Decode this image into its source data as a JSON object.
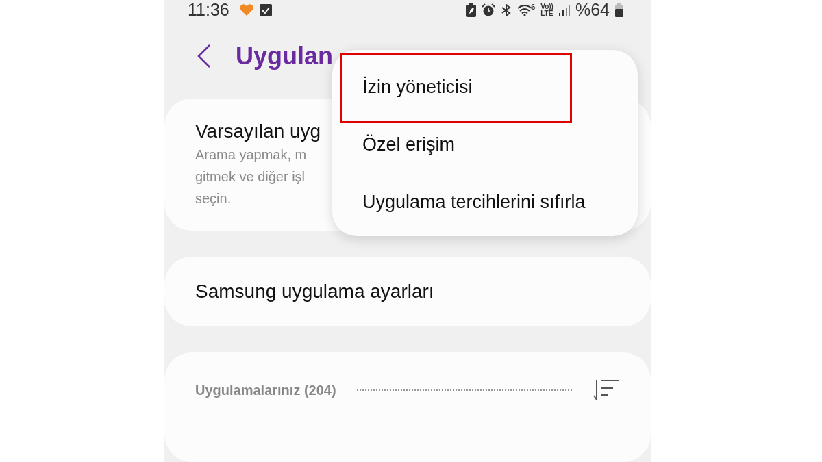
{
  "status_bar": {
    "time": "11:36",
    "wifi_badge": "6",
    "volte_top": "Vo))",
    "volte_bottom": "LTE",
    "battery_percent": "%64"
  },
  "header": {
    "title": "Uygulan"
  },
  "cards": [
    {
      "kind": "default_apps",
      "title": "Varsayılan uyg",
      "subtitle_lines": [
        "Arama yapmak, m",
        "gitmek ve diğer işl",
        "seçin."
      ]
    },
    {
      "kind": "plain",
      "title": "Samsung uygulama ayarları"
    },
    {
      "kind": "apps_header",
      "title": "Uygulamalarınız (204)"
    }
  ],
  "menu": {
    "items": [
      {
        "label": "İzin yöneticisi",
        "highlighted": true
      },
      {
        "label": "Özel erişim",
        "highlighted": false
      },
      {
        "label": "Uygulama tercihlerini sıfırla",
        "highlighted": false
      }
    ]
  }
}
